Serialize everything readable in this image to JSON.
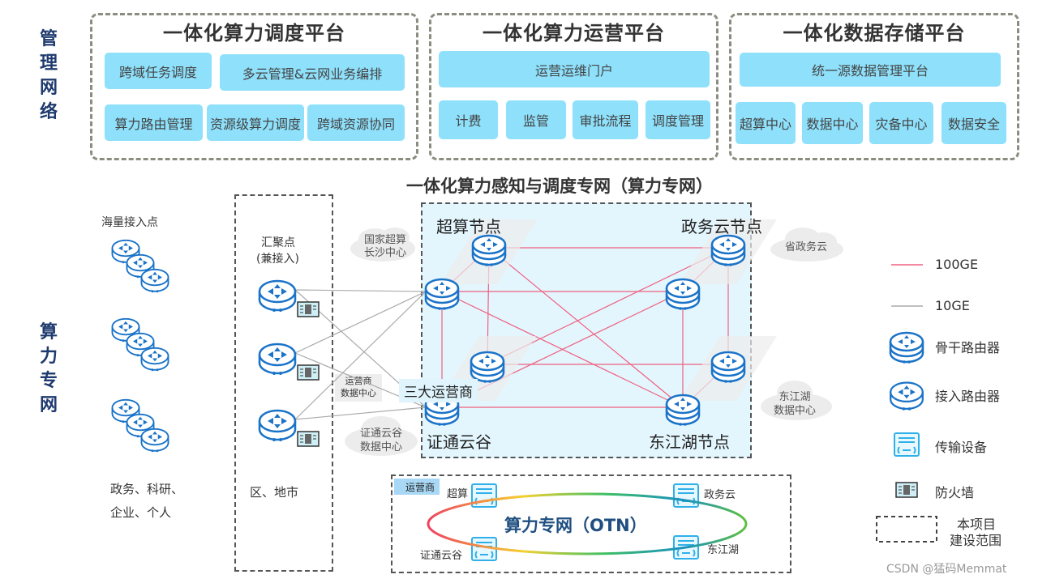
{
  "side_labels": {
    "management": "管理网络",
    "compute_network": "算力专网"
  },
  "platforms": [
    {
      "title": "一体化算力调度平台",
      "rows": [
        [
          "跨域任务调度",
          "多云管理&云网业务编排"
        ],
        [
          "算力路由管理",
          "资源级算力调度",
          "跨域资源协同"
        ]
      ]
    },
    {
      "title": "一体化算力运营平台",
      "rows": [
        [
          "运营运维门户"
        ],
        [
          "计费",
          "监管",
          "审批流程",
          "调度管理"
        ]
      ]
    },
    {
      "title": "一体化数据存储平台",
      "rows": [
        [
          "统一源数据管理平台"
        ],
        [
          "超算中心",
          "数据中心",
          "灾备中心",
          "数据安全"
        ]
      ]
    }
  ],
  "access": {
    "title": "海量接入点",
    "caption_line1": "政务、科研、",
    "caption_line2": "企业、个人"
  },
  "aggregation": {
    "title_line1": "汇聚点",
    "title_line2": "(兼接入)",
    "caption": "区、地市"
  },
  "network": {
    "title": "一体化算力感知与调度专网（算力专网）",
    "nodes": {
      "supercomputing": "超算节点",
      "gov_cloud": "政务云节点",
      "zhengtong": "证通云谷",
      "dongjianghu": "东江湖节点",
      "carriers": "三大运营商"
    },
    "clouds": {
      "national_sc_line1": "国家超算",
      "national_sc_line2": "长沙中心",
      "provincial_gov": "省政务云",
      "carrier_dc_line1": "运营商",
      "carrier_dc_line2": "数据中心",
      "zhengtong_dc_line1": "证通云谷",
      "zhengtong_dc_line2": "数据中心",
      "djh_dc_line1": "东江湖",
      "djh_dc_line2": "数据中心"
    }
  },
  "otn": {
    "tag": "运营商",
    "title": "算力专网（OTN）",
    "sites": [
      "超算",
      "政务云",
      "证通云谷",
      "东江湖"
    ]
  },
  "legend": {
    "items": [
      {
        "icon": "line-red",
        "label": "100GE",
        "color": "#f06080"
      },
      {
        "icon": "line-gray",
        "label": "10GE",
        "color": "#aaaaaa"
      },
      {
        "icon": "backbone-router-icon",
        "label": "骨干路由器"
      },
      {
        "icon": "access-router-icon",
        "label": "接入路由器"
      },
      {
        "icon": "transmission-device-icon",
        "label": "传输设备"
      },
      {
        "icon": "firewall-icon",
        "label": "防火墙"
      }
    ],
    "scope_line1": "本项目",
    "scope_line2": "建设范围"
  },
  "watermark": "CSDN @猛码Memmat",
  "colors": {
    "tile": "#8ee0fb",
    "router_blue": "#1a73c8",
    "link_100ge": "#f06080",
    "link_10ge": "#aaaaaa",
    "net_bg": "#e3f6fd",
    "side_label": "#1f3a6e"
  }
}
